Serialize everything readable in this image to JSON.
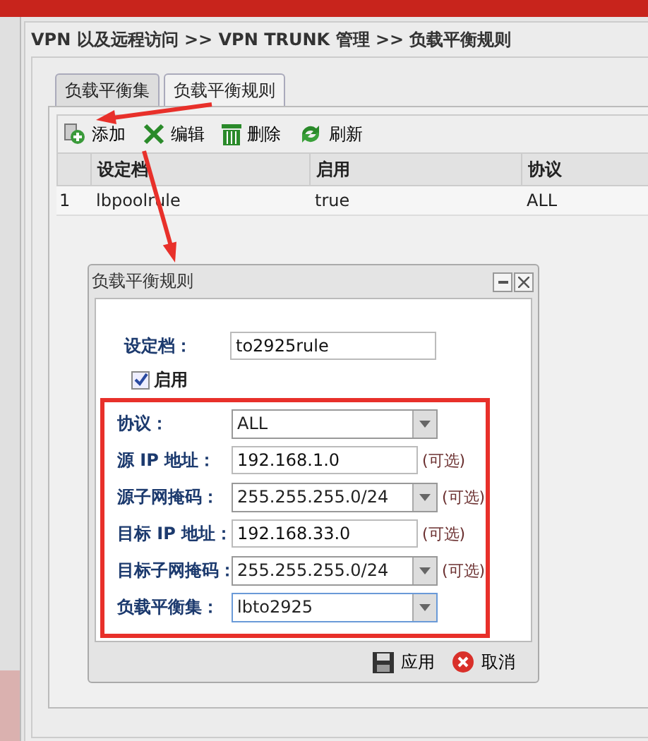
{
  "breadcrumb": "VPN 以及远程访问 >> VPN TRUNK 管理 >> 负载平衡规则",
  "tabs": [
    {
      "label": "负载平衡集",
      "selected": false
    },
    {
      "label": "负载平衡规则",
      "selected": true
    }
  ],
  "toolbar": [
    {
      "kind": "add",
      "label": "添加"
    },
    {
      "kind": "edit",
      "label": "编辑"
    },
    {
      "kind": "delete",
      "label": "删除"
    },
    {
      "kind": "refresh",
      "label": "刷新"
    }
  ],
  "table": {
    "columns": [
      "设定档",
      "启用",
      "协议"
    ],
    "rows": [
      {
        "index": "1",
        "cells": [
          "lbpoolrule",
          "true",
          "ALL"
        ]
      }
    ]
  },
  "dialog": {
    "title": "负载平衡规则",
    "profile": {
      "label": "设定档：",
      "value": "to2925rule"
    },
    "enabled": {
      "label": "启用",
      "checked": true
    },
    "fields": [
      {
        "kind": "select",
        "label": "协议：",
        "value": "ALL",
        "focused": false
      },
      {
        "kind": "text",
        "label": "源 IP 地址：",
        "value": "192.168.1.0",
        "note": "(可选)",
        "focused": false
      },
      {
        "kind": "select",
        "label": "源子网掩码：",
        "value": "255.255.255.0/24",
        "note": "(可选)",
        "focused": false
      },
      {
        "kind": "text",
        "label": "目标 IP 地址：",
        "value": "192.168.33.0",
        "note": "(可选)",
        "focused": false
      },
      {
        "kind": "select",
        "label": "目标子网掩码：",
        "value": "255.255.255.0/24",
        "note": "(可选)",
        "focused": false
      },
      {
        "kind": "select",
        "label": "负载平衡集：",
        "value": "lbto2925",
        "focused": true
      }
    ],
    "buttons": [
      {
        "kind": "apply",
        "label": "应用"
      },
      {
        "kind": "cancel",
        "label": "取消"
      }
    ]
  }
}
